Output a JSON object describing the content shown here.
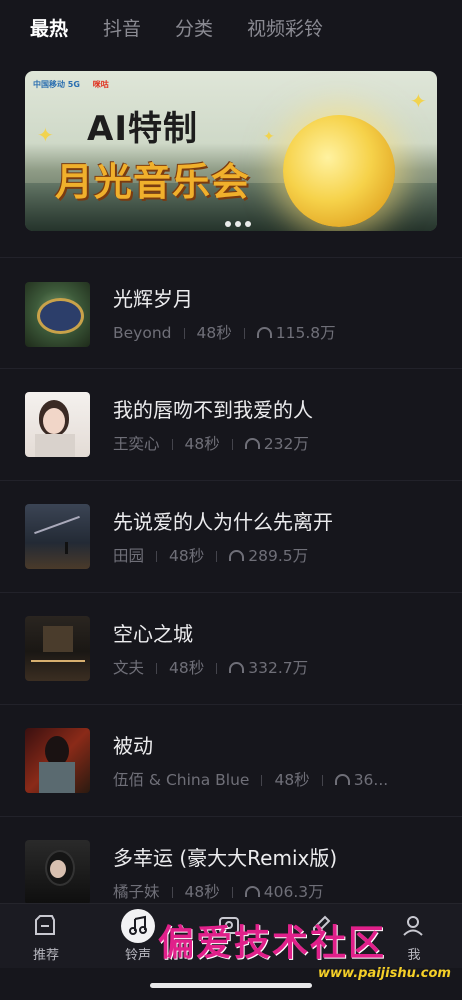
{
  "tabs": [
    "最热",
    "抖音",
    "分类",
    "视频彩铃"
  ],
  "banner": {
    "logo_left": "中国移动 5G",
    "logo_right": "咪咕",
    "title_line1": "AI特制",
    "title_line2": "月光音乐会"
  },
  "songs": [
    {
      "title": "光辉岁月",
      "artist": "Beyond",
      "duration": "48秒",
      "plays": "115.8万"
    },
    {
      "title": "我的唇吻不到我爱的人",
      "artist": "王奕心",
      "duration": "48秒",
      "plays": "232万"
    },
    {
      "title": "先说爱的人为什么先离开",
      "artist": "田园",
      "duration": "48秒",
      "plays": "289.5万"
    },
    {
      "title": "空心之城",
      "artist": "文夫",
      "duration": "48秒",
      "plays": "332.7万"
    },
    {
      "title": "被动",
      "artist": "伍佰 & China Blue",
      "duration": "48秒",
      "plays": "36..."
    },
    {
      "title": "多幸运 (豪大大Remix版)",
      "artist": "橘子妹",
      "duration": "48秒",
      "plays": "406.3万"
    }
  ],
  "nav": [
    {
      "label": "推荐",
      "icon": "recommend-icon"
    },
    {
      "label": "铃声",
      "icon": "music-note-icon"
    },
    {
      "label": "",
      "icon": "video-icon"
    },
    {
      "label": "",
      "icon": "edit-icon"
    },
    {
      "label": "我",
      "icon": "profile-icon"
    }
  ],
  "watermark": {
    "text": "偏爱技术社区",
    "url": "www.paijishu.com"
  },
  "colors": {
    "background": "#16161c",
    "accent_yellow": "#f0b02c"
  }
}
